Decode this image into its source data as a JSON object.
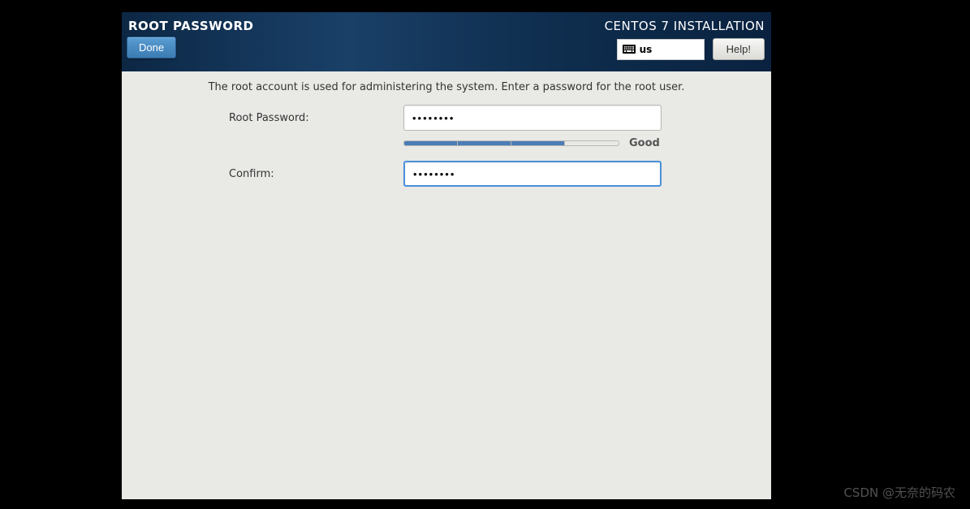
{
  "header": {
    "title": "ROOT PASSWORD",
    "subtitle": "CENTOS 7 INSTALLATION",
    "done_label": "Done",
    "help_label": "Help!",
    "keyboard_layout": "us"
  },
  "content": {
    "description": "The root account is used for administering the system.  Enter a password for the root user.",
    "password_label": "Root Password:",
    "confirm_label": "Confirm:",
    "password_value": "••••••••",
    "confirm_value": "••••••••",
    "strength_label": "Good",
    "strength_segments": 4,
    "strength_filled": 3
  },
  "watermark": "CSDN @无奈的码农"
}
